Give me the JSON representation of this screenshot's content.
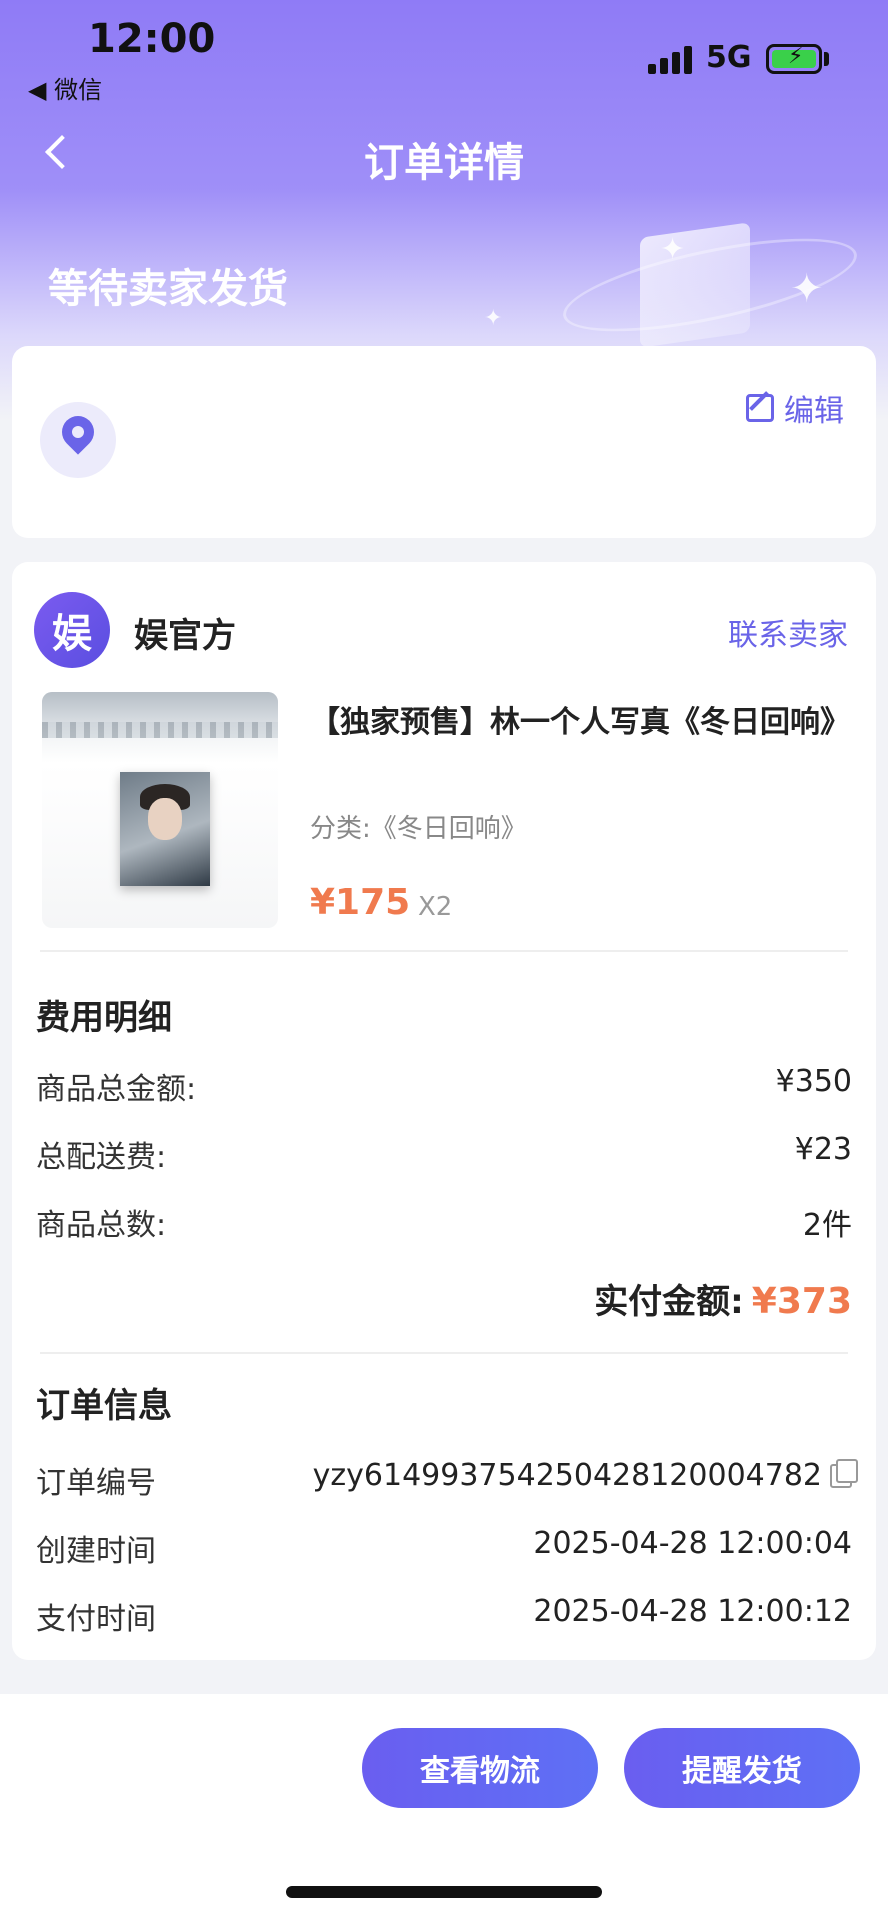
{
  "status_bar": {
    "time": "12:00",
    "back_app": "◀ 微信",
    "network": "5G"
  },
  "nav": {
    "title": "订单详情"
  },
  "order_status": "等待卖家发货",
  "address": {
    "edit_label": "编辑"
  },
  "shop": {
    "logo_text": "娱",
    "name": "娱官方",
    "contact_label": "联系卖家"
  },
  "product": {
    "title": "【独家预售】林一个人写真《冬日回响》",
    "category": "分类:《冬日回响》",
    "price": "¥175",
    "quantity": "X2"
  },
  "fees": {
    "title": "费用明细",
    "rows": [
      {
        "label": "商品总金额:",
        "value": "¥350"
      },
      {
        "label": "总配送费:",
        "value": "¥23"
      },
      {
        "label": "商品总数:",
        "value": "2件"
      }
    ],
    "total_label": "实付金额:",
    "total_value": "¥373"
  },
  "order_info": {
    "title": "订单信息",
    "rows": [
      {
        "label": "订单编号",
        "value": "yzy61499375425042812000478​2"
      },
      {
        "label": "创建时间",
        "value": "2025-04-28 12:00:04"
      },
      {
        "label": "支付时间",
        "value": "2025-04-28 12:00:12"
      }
    ]
  },
  "actions": {
    "logistics_label": "查看物流",
    "remind_label": "提醒发货"
  },
  "colors": {
    "accent": "#6a64e8",
    "price": "#f07a4e",
    "header_start": "#8f7bf6"
  }
}
